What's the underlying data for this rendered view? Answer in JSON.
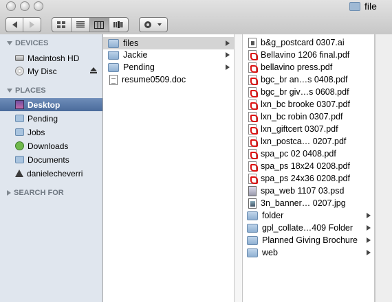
{
  "window": {
    "title": "file"
  },
  "sidebar": {
    "devices_label": "DEVICES",
    "places_label": "PLACES",
    "search_label": "SEARCH FOR",
    "devices": [
      {
        "label": "Macintosh HD",
        "icon": "hard-drive-icon"
      },
      {
        "label": "My Disc",
        "icon": "disc-icon"
      }
    ],
    "places": [
      {
        "label": "Desktop",
        "icon": "desktop-icon",
        "selected": true
      },
      {
        "label": "Pending",
        "icon": "folder-icon"
      },
      {
        "label": "Jobs",
        "icon": "folder-icon"
      },
      {
        "label": "Downloads",
        "icon": "downloads-icon"
      },
      {
        "label": "Documents",
        "icon": "folder-icon"
      },
      {
        "label": "danielecheverri",
        "icon": "home-icon"
      }
    ]
  },
  "columns": {
    "first": [
      {
        "name": "files",
        "type": "folder",
        "selected": true
      },
      {
        "name": "Jackie",
        "type": "folder"
      },
      {
        "name": "Pending",
        "type": "folder"
      },
      {
        "name": "resume0509.doc",
        "type": "doc"
      }
    ],
    "second": [
      {
        "name": "b&g_postcard 0307.ai",
        "type": "ai"
      },
      {
        "name": "Bellavino 1206 final.pdf",
        "type": "pdf"
      },
      {
        "name": "bellavino press.pdf",
        "type": "pdf"
      },
      {
        "name": "bgc_br an…s 0408.pdf",
        "type": "pdf"
      },
      {
        "name": "bgc_br giv…s 0608.pdf",
        "type": "pdf"
      },
      {
        "name": "lxn_bc brooke 0307.pdf",
        "type": "pdf"
      },
      {
        "name": "lxn_bc robin 0307.pdf",
        "type": "pdf"
      },
      {
        "name": "lxn_giftcert 0307.pdf",
        "type": "pdf"
      },
      {
        "name": "lxn_postca… 0207.pdf",
        "type": "pdf"
      },
      {
        "name": "spa_pc 02 0408.pdf",
        "type": "pdf"
      },
      {
        "name": "spa_ps 18x24 0208.pdf",
        "type": "pdf"
      },
      {
        "name": "spa_ps 24x36 0208.pdf",
        "type": "pdf"
      },
      {
        "name": "spa_web 1107 03.psd",
        "type": "psd"
      },
      {
        "name": "3n_banner… 0207.jpg",
        "type": "jpg"
      },
      {
        "name": "folder",
        "type": "folder"
      },
      {
        "name": "gpl_collate…409 Folder",
        "type": "folder"
      },
      {
        "name": "Planned Giving Brochure",
        "type": "folder"
      },
      {
        "name": "web",
        "type": "folder"
      }
    ]
  },
  "colors": {
    "selection": "#4a6b9b",
    "sidebar_bg": "#e0e6ee"
  }
}
